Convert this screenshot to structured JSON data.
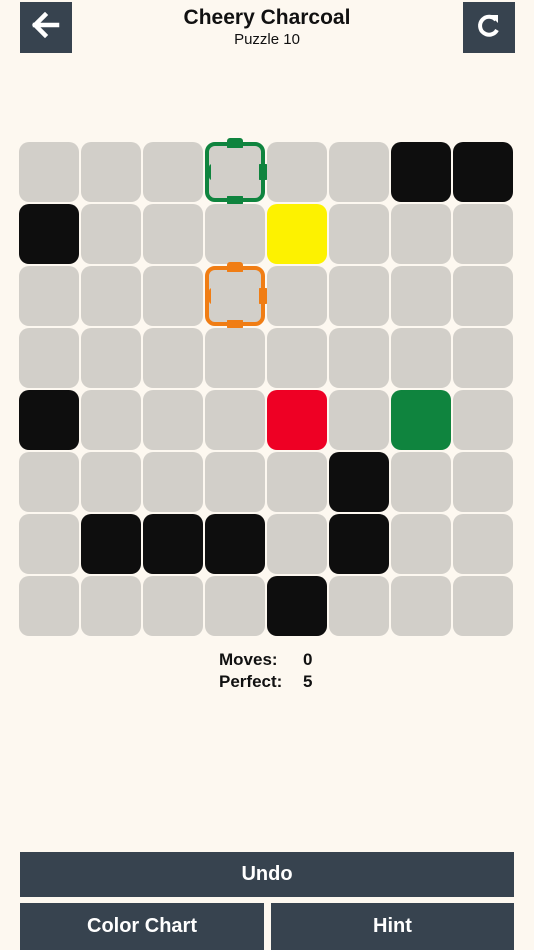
{
  "header": {
    "title": "Cheery Charcoal",
    "subtitle": "Puzzle 10"
  },
  "icons": {
    "back": "arrow-left-icon",
    "refresh": "refresh-icon"
  },
  "colors": {
    "empty": "#d2cfc9",
    "black": "#0e0e0e",
    "yellow": "#fdf200",
    "red": "#ee0024",
    "green": "#0f843e",
    "orange": "#f07d14",
    "button": "#37434f",
    "background": "#fdf8f0"
  },
  "board": {
    "rows": 8,
    "cols": 8,
    "grid": [
      [
        "empty",
        "empty",
        "empty",
        "target-green",
        "empty",
        "empty",
        "black",
        "black"
      ],
      [
        "black",
        "empty",
        "empty",
        "empty",
        "yellow",
        "empty",
        "empty",
        "empty"
      ],
      [
        "empty",
        "empty",
        "empty",
        "target-orange",
        "empty",
        "empty",
        "empty",
        "empty"
      ],
      [
        "empty",
        "empty",
        "empty",
        "empty",
        "empty",
        "empty",
        "empty",
        "empty"
      ],
      [
        "black",
        "empty",
        "empty",
        "empty",
        "red",
        "empty",
        "green",
        "empty"
      ],
      [
        "empty",
        "empty",
        "empty",
        "empty",
        "empty",
        "black",
        "empty",
        "empty"
      ],
      [
        "empty",
        "black",
        "black",
        "black",
        "empty",
        "black",
        "empty",
        "empty"
      ],
      [
        "empty",
        "empty",
        "empty",
        "empty",
        "black",
        "empty",
        "empty",
        "empty"
      ]
    ]
  },
  "stats": {
    "moves_label": "Moves:",
    "moves_value": "0",
    "perfect_label": "Perfect:",
    "perfect_value": "5"
  },
  "buttons": {
    "undo": "Undo",
    "color_chart": "Color Chart",
    "hint": "Hint"
  }
}
